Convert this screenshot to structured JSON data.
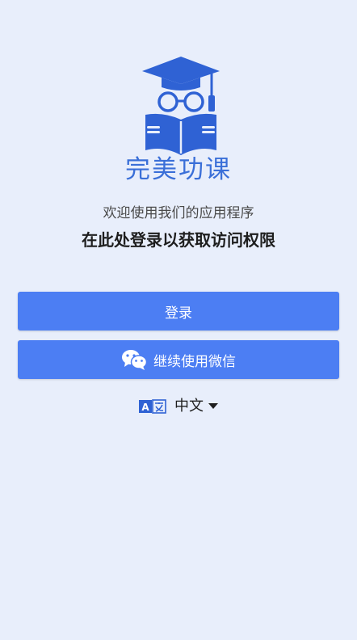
{
  "app": {
    "name": "完美功课",
    "brand_color": "#3a6fd8"
  },
  "welcome": {
    "subtitle": "欢迎使用我们的应用程序",
    "instruction": "在此处登录以获取访问权限"
  },
  "actions": {
    "login_label": "登录",
    "wechat_label": "继续使用微信",
    "button_color": "#4c7ef3"
  },
  "language": {
    "icon": "translate-icon",
    "selected": "中文"
  }
}
